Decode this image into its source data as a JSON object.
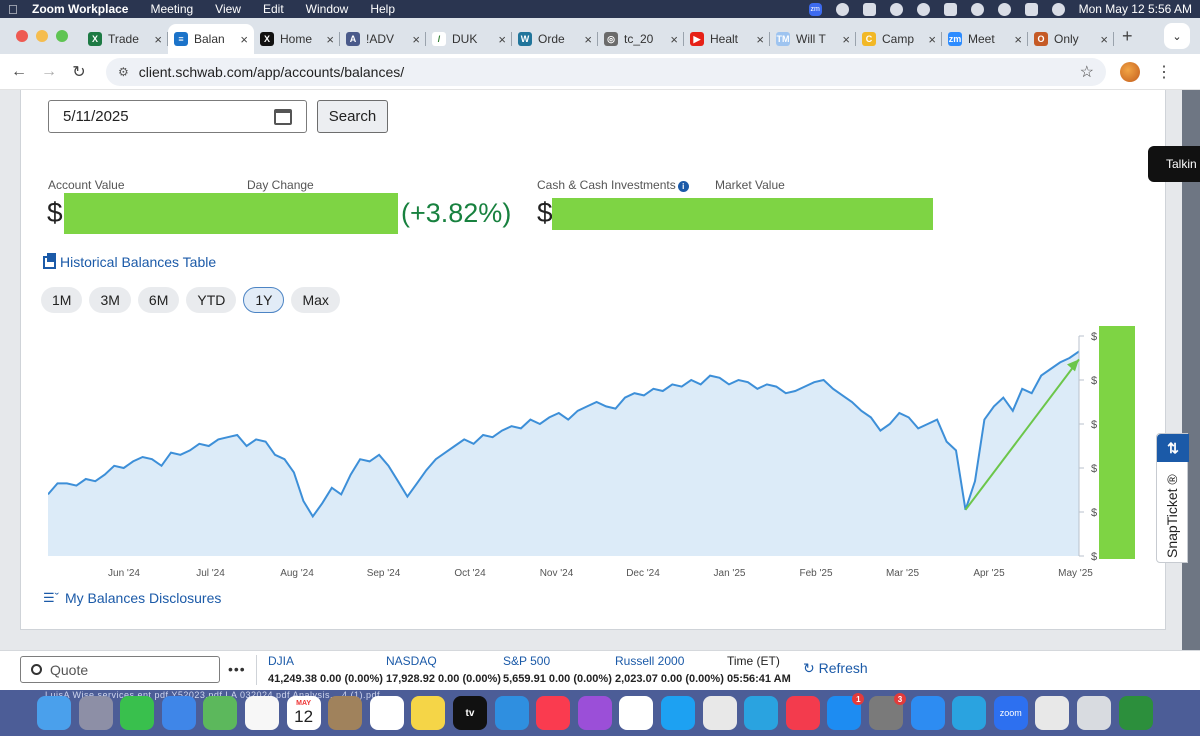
{
  "menubar": {
    "app": "Zoom Workplace",
    "menus": [
      "Meeting",
      "View",
      "Edit",
      "Window",
      "Help"
    ],
    "clock": "Mon May 12  5:56 AM",
    "zoom_icon_text": "zm"
  },
  "tabs": [
    {
      "title": "Trade",
      "icon": "excel-icon",
      "color": "#1d7a44",
      "glyph": "X"
    },
    {
      "title": "Balan",
      "icon": "schwab-icon",
      "color": "#1b73c9",
      "glyph": "≡",
      "active": true
    },
    {
      "title": "Home",
      "icon": "x-logo-icon",
      "color": "#111111",
      "glyph": "X"
    },
    {
      "title": "!ADV",
      "icon": "doc-icon",
      "color": "#4a5a8a",
      "glyph": "A"
    },
    {
      "title": "DUK",
      "icon": "slash-icon",
      "color": "#ffffff",
      "glyph": "/"
    },
    {
      "title": "Orde",
      "icon": "wordpress-icon",
      "color": "#21759b",
      "glyph": "W"
    },
    {
      "title": "tc_20",
      "icon": "globe-icon",
      "color": "#6b6b6b",
      "glyph": "◎"
    },
    {
      "title": "Healt",
      "icon": "youtube-icon",
      "color": "#e62117",
      "glyph": "▶"
    },
    {
      "title": "Will T",
      "icon": "tm-icon",
      "color": "#9ec4f0",
      "glyph": "TM"
    },
    {
      "title": "Camp",
      "icon": "campaign-icon",
      "color": "#f2b826",
      "glyph": "C"
    },
    {
      "title": "Meet",
      "icon": "zoom-icon",
      "color": "#2d8cff",
      "glyph": "zm"
    },
    {
      "title": "Only",
      "icon": "only-icon",
      "color": "#c55a26",
      "glyph": "O"
    }
  ],
  "toolbar": {
    "url": "client.schwab.com/app/accounts/balances/"
  },
  "search_form": {
    "date_value": "5/11/2025",
    "search_label": "Search"
  },
  "balances": {
    "account_value_label": "Account Value",
    "day_change_label": "Day Change",
    "currency": "$",
    "day_change_pct": "(+3.82%)",
    "cash_label": "Cash & Cash Investments",
    "info_glyph": "i",
    "market_value_label": "Market Value",
    "redaction_color": "#7ed444"
  },
  "historical_link": "Historical Balances Table",
  "ranges": [
    {
      "label": "1M"
    },
    {
      "label": "3M"
    },
    {
      "label": "6M"
    },
    {
      "label": "YTD"
    },
    {
      "label": "1Y",
      "active": true
    },
    {
      "label": "Max"
    }
  ],
  "chart_data": {
    "type": "area",
    "x_ticks": [
      "Jun '24",
      "Jul '24",
      "Aug '24",
      "Sep '24",
      "Oct '24",
      "Nov '24",
      "Dec '24",
      "Jan '25",
      "Feb '25",
      "Mar '25",
      "Apr '25",
      "May '25"
    ],
    "y_tick_label": "$",
    "y_tick_count": 6,
    "ylim": [
      0,
      100
    ],
    "series": [
      {
        "values": [
          28,
          33,
          33,
          32,
          35,
          34,
          37,
          41,
          40,
          43,
          45,
          44,
          41,
          47,
          46,
          48,
          51,
          50,
          53,
          54,
          55,
          50,
          53,
          52,
          46,
          44,
          38,
          25,
          18,
          24,
          31,
          28,
          37,
          44,
          43,
          46,
          41,
          34,
          27,
          33,
          39,
          44,
          47,
          50,
          53,
          51,
          55,
          54,
          57,
          59,
          58,
          62,
          60,
          63,
          65,
          62,
          66,
          68,
          70,
          68,
          67,
          72,
          74,
          73,
          76,
          75,
          78,
          77,
          80,
          78,
          82,
          81,
          78,
          80,
          79,
          76,
          78,
          77,
          74,
          75,
          77,
          79,
          80,
          76,
          73,
          70,
          66,
          63,
          57,
          60,
          65,
          63,
          58,
          60,
          62,
          52,
          48,
          21,
          34,
          62,
          68,
          72,
          66,
          76,
          74,
          82,
          85,
          88,
          90,
          93
        ]
      }
    ],
    "trend_arrow": true,
    "grid": false,
    "area_color": "#dcebf8",
    "line_color": "#3d8fd8",
    "arrow_color": "#6cc64a"
  },
  "disclosures_link": "My Balances Disclosures",
  "side": {
    "talkin": "Talkin",
    "snapticket": "SnapTicket",
    "snapticket_glyph": "⇅",
    "reg": "®"
  },
  "quotebar": {
    "quote_placeholder": "Quote",
    "more": "•••",
    "indices": [
      {
        "name": "DJIA",
        "value": "41,249.38 0.00 (0.00%)"
      },
      {
        "name": "NASDAQ",
        "value": "17,928.92 0.00 (0.00%)"
      },
      {
        "name": "S&P 500",
        "value": "5,659.91 0.00 (0.00%)"
      },
      {
        "name": "Russell 2000",
        "value": "2,023.07 0.00 (0.00%)"
      }
    ],
    "time_label": "Time (ET)",
    "time_value": "05:56:41 AM",
    "refresh_label": "Refresh"
  },
  "dock": {
    "under_text": "LuisA Wise     services  ent pdf        Y52023.pdf      LA 032024.pdf     Analysis... 4 (1).pdf",
    "calendar_month": "MAY",
    "calendar_day": "12",
    "tv_label": "tv",
    "zoom_label": "zoom",
    "badges": {
      "appstore": "1",
      "settings": "3"
    },
    "icons": [
      "finder-icon",
      "launchpad-icon",
      "messages-icon",
      "mail-icon",
      "maps-icon",
      "photos-icon",
      "calendar-icon",
      "contacts-icon",
      "reminders-icon",
      "notes-icon",
      "appletv-icon",
      "snowflake-icon",
      "music-icon",
      "podcasts-icon",
      "chrome-icon",
      "twitter-icon",
      "acrobat-icon",
      "telegram-icon",
      "news-icon",
      "appstore-icon",
      "settings-icon",
      "safari-icon",
      "telegram2-icon",
      "zoom-icon",
      "preview-icon",
      "trash-icon",
      "pen-icon"
    ]
  }
}
